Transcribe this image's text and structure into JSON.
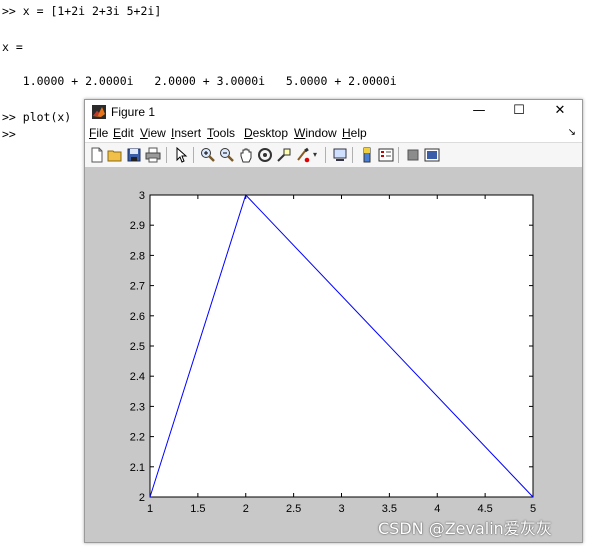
{
  "console": {
    "line1": ">> x = [1+2i 2+3i 5+2i]",
    "line2": "x =",
    "line3": "   1.0000 + 2.0000i   2.0000 + 3.0000i   5.0000 + 2.0000i",
    "line4": ">> plot(x)",
    "line5": ">>"
  },
  "figure": {
    "title": "Figure 1",
    "minimize": "—",
    "maximize": "☐",
    "close": "✕",
    "dock_arrow": "↘",
    "menu": [
      {
        "label": "File",
        "mn": "F",
        "rest": "ile"
      },
      {
        "label": "Edit",
        "mn": "E",
        "rest": "dit"
      },
      {
        "label": "View",
        "mn": "V",
        "rest": "iew"
      },
      {
        "label": "Insert",
        "mn": "I",
        "rest": "nsert"
      },
      {
        "label": "Tools",
        "mn": "T",
        "rest": "ools"
      },
      {
        "label": "Desktop",
        "mn": "D",
        "rest": "esktop"
      },
      {
        "label": "Window",
        "mn": "W",
        "rest": "indow"
      },
      {
        "label": "Help",
        "mn": "H",
        "rest": "elp"
      }
    ],
    "toolbar_icons": [
      "new-figure-icon",
      "open-file-icon",
      "save-icon",
      "print-icon",
      "pointer-icon",
      "zoom-in-icon",
      "zoom-out-icon",
      "pan-icon",
      "rotate-3d-icon",
      "data-cursor-icon",
      "brush-icon",
      "link-plot-icon",
      "colorbar-icon",
      "legend-icon",
      "hide-plot-tools-icon",
      "show-plot-tools-icon"
    ]
  },
  "chart_data": {
    "type": "line",
    "x": [
      1,
      2,
      5
    ],
    "y": [
      2,
      3,
      2
    ],
    "xlim": [
      1,
      5
    ],
    "ylim": [
      2,
      3
    ],
    "xticks": [
      "1",
      "1.5",
      "2",
      "2.5",
      "3",
      "3.5",
      "4",
      "4.5",
      "5"
    ],
    "yticks": [
      "2",
      "2.1",
      "2.2",
      "2.3",
      "2.4",
      "2.5",
      "2.6",
      "2.7",
      "2.8",
      "2.9",
      "3"
    ],
    "line_color": "#0000ff",
    "grid": false,
    "title": "",
    "xlabel": "",
    "ylabel": ""
  },
  "watermark": "CSDN @Zevalin爱灰灰"
}
